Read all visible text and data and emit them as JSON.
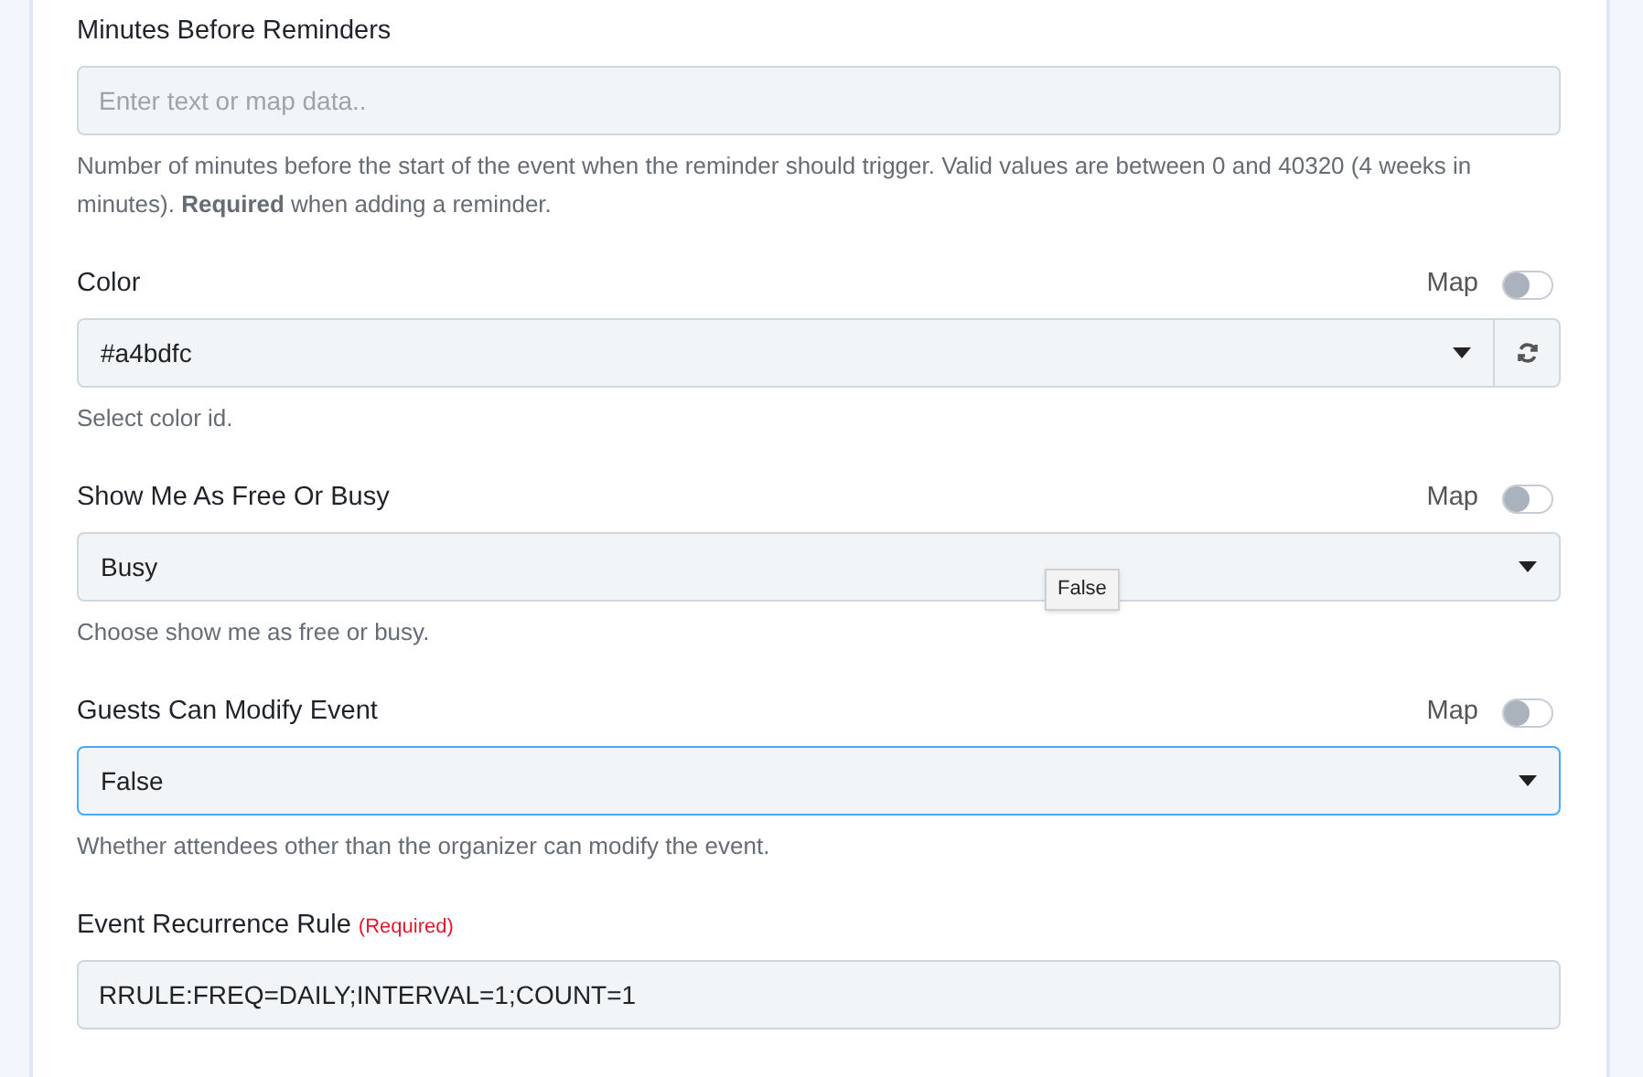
{
  "fields": [
    {
      "kind": "text",
      "label": "Minutes Before Reminders",
      "placeholder": "Enter text or map data..",
      "help": "Number of minutes before the start of the event when the reminder should trigger. Valid values are between 0 and 40320 (4 weeks in minutes). **Required** when adding a reminder."
    },
    {
      "kind": "select_refresh",
      "label": "Color",
      "map_label": "Map",
      "map_on": false,
      "value": "#a4bdfc",
      "focused": false,
      "help": "Select color id."
    },
    {
      "kind": "select",
      "label": "Show Me As Free Or Busy",
      "map_label": "Map",
      "map_on": false,
      "value": "Busy",
      "focused": false,
      "help": "Choose show me as free or busy.",
      "tooltip": "False"
    },
    {
      "kind": "select",
      "label": "Guests Can Modify Event",
      "map_label": "Map",
      "map_on": false,
      "value": "False",
      "focused": true,
      "help": "Whether attendees other than the organizer can modify the event."
    },
    {
      "kind": "text",
      "label": "Event Recurrence Rule",
      "required": "(Required)",
      "value": "RRULE:FREQ=DAILY;INTERVAL=1;COUNT=1"
    }
  ]
}
